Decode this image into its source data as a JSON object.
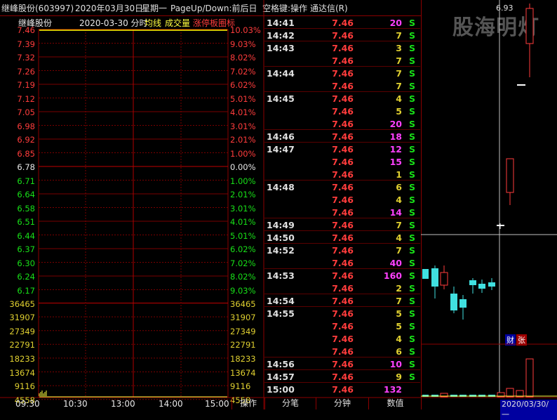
{
  "title": {
    "stock": "继峰股份(603997)",
    "date": "2020年03月30日",
    "weekday": "星期一",
    "nav": "PageUp/Down:前后日",
    "space": "空格键:操作",
    "app": "通达信(R)"
  },
  "chart_header": {
    "name": "继峰股份",
    "date_label": "2020-03-30 分时",
    "avg_line": "均线",
    "volume": "成交量",
    "limit": "涨停板圈标"
  },
  "price_axis": [
    "7.46",
    "7.39",
    "7.32",
    "7.26",
    "7.19",
    "7.12",
    "7.05",
    "6.98",
    "6.92",
    "6.85",
    "6.78",
    "6.71",
    "6.64",
    "6.58",
    "6.51",
    "6.44",
    "6.37",
    "6.30",
    "6.24",
    "6.17"
  ],
  "pct_axis": [
    "10.03%",
    "9.03%",
    "8.02%",
    "7.02%",
    "6.02%",
    "5.01%",
    "4.01%",
    "3.01%",
    "2.01%",
    "1.00%",
    "0.00%",
    "1.00%",
    "2.01%",
    "3.01%",
    "4.01%",
    "5.01%",
    "6.02%",
    "7.02%",
    "8.02%",
    "9.03%"
  ],
  "volume_axis": [
    "36465",
    "31907",
    "27349",
    "22791",
    "18233",
    "13674",
    "9116",
    "4558"
  ],
  "time_axis": [
    "09:30",
    "10:30",
    "13:00",
    "14:00",
    "15:00"
  ],
  "trades": [
    {
      "time": "14:41",
      "price": "7.46",
      "vol": "20",
      "flag": "S",
      "color": "mag"
    },
    {
      "time": "14:42",
      "price": "7.46",
      "vol": "7",
      "flag": "S",
      "color": "yellow"
    },
    {
      "time": "14:43",
      "price": "7.46",
      "vol": "3",
      "flag": "S",
      "color": "yellow"
    },
    {
      "time": "",
      "price": "7.46",
      "vol": "7",
      "flag": "S",
      "color": "yellow"
    },
    {
      "time": "14:44",
      "price": "7.46",
      "vol": "7",
      "flag": "S",
      "color": "yellow"
    },
    {
      "time": "",
      "price": "7.46",
      "vol": "7",
      "flag": "S",
      "color": "yellow"
    },
    {
      "time": "14:45",
      "price": "7.46",
      "vol": "4",
      "flag": "S",
      "color": "yellow"
    },
    {
      "time": "",
      "price": "7.46",
      "vol": "5",
      "flag": "S",
      "color": "yellow"
    },
    {
      "time": "",
      "price": "7.46",
      "vol": "20",
      "flag": "S",
      "color": "mag"
    },
    {
      "time": "14:46",
      "price": "7.46",
      "vol": "18",
      "flag": "S",
      "color": "mag"
    },
    {
      "time": "14:47",
      "price": "7.46",
      "vol": "12",
      "flag": "S",
      "color": "mag"
    },
    {
      "time": "",
      "price": "7.46",
      "vol": "15",
      "flag": "S",
      "color": "mag"
    },
    {
      "time": "",
      "price": "7.46",
      "vol": "1",
      "flag": "S",
      "color": "yellow"
    },
    {
      "time": "14:48",
      "price": "7.46",
      "vol": "6",
      "flag": "S",
      "color": "yellow"
    },
    {
      "time": "",
      "price": "7.46",
      "vol": "4",
      "flag": "S",
      "color": "yellow"
    },
    {
      "time": "",
      "price": "7.46",
      "vol": "14",
      "flag": "S",
      "color": "mag"
    },
    {
      "time": "14:49",
      "price": "7.46",
      "vol": "7",
      "flag": "S",
      "color": "yellow"
    },
    {
      "time": "14:50",
      "price": "7.46",
      "vol": "4",
      "flag": "S",
      "color": "yellow"
    },
    {
      "time": "14:52",
      "price": "7.46",
      "vol": "7",
      "flag": "S",
      "color": "yellow"
    },
    {
      "time": "",
      "price": "7.46",
      "vol": "40",
      "flag": "S",
      "color": "mag"
    },
    {
      "time": "14:53",
      "price": "7.46",
      "vol": "160",
      "flag": "S",
      "color": "mag"
    },
    {
      "time": "",
      "price": "7.46",
      "vol": "2",
      "flag": "S",
      "color": "yellow"
    },
    {
      "time": "14:54",
      "price": "7.46",
      "vol": "7",
      "flag": "S",
      "color": "yellow"
    },
    {
      "time": "14:55",
      "price": "7.46",
      "vol": "5",
      "flag": "S",
      "color": "yellow"
    },
    {
      "time": "",
      "price": "7.46",
      "vol": "5",
      "flag": "S",
      "color": "yellow"
    },
    {
      "time": "",
      "price": "7.46",
      "vol": "4",
      "flag": "S",
      "color": "yellow"
    },
    {
      "time": "",
      "price": "7.46",
      "vol": "6",
      "flag": "S",
      "color": "yellow"
    },
    {
      "time": "14:56",
      "price": "7.46",
      "vol": "10",
      "flag": "S",
      "color": "mag"
    },
    {
      "time": "14:57",
      "price": "7.46",
      "vol": "9",
      "flag": "S",
      "color": "yellow"
    },
    {
      "time": "15:00",
      "price": "7.46",
      "vol": "132",
      "flag": "",
      "color": "mag"
    }
  ],
  "right_panel": {
    "watermark": "股海明灯",
    "price_label": "6.93",
    "badge_cai": "财",
    "badge_zhang": "张",
    "date": "2020/03/30/一"
  },
  "tabs": [
    "操作",
    "分笔",
    "分钟",
    "数值"
  ]
}
